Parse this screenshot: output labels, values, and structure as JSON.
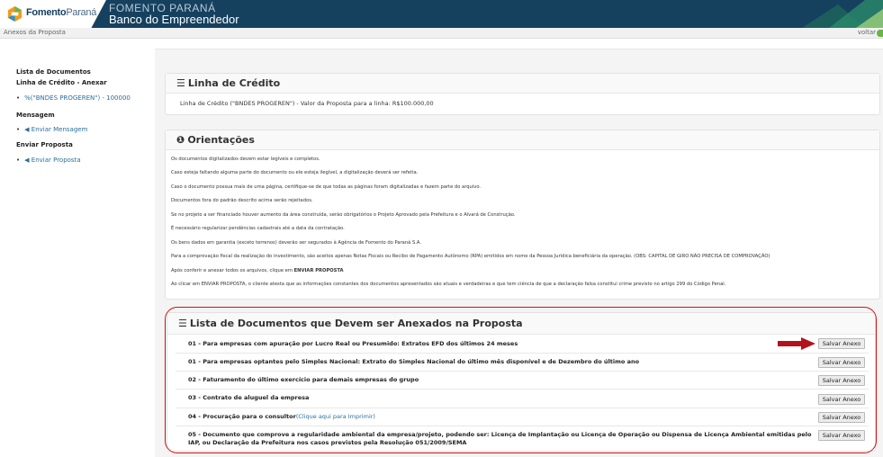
{
  "header": {
    "logo_bold": "Fomento",
    "logo_light": "Paraná",
    "title_line1": "FOMENTO PARANÁ",
    "title_line2": "Banco do Empreendedor"
  },
  "subbar": {
    "breadcrumb": "Anexos da Proposta",
    "back_label": "voltar"
  },
  "sidebar": {
    "docs_heading": "Lista de Documentos",
    "credit_heading": "Linha de Crédito - Anexar",
    "credit_item": "%(\"BNDES PROGEREN\") - 100000",
    "message_heading": "Mensagem",
    "message_item": "Enviar Mensagem",
    "submit_heading": "Enviar Proposta",
    "submit_item": "Enviar Proposta"
  },
  "credit_panel": {
    "title": "Linha de Crédito",
    "text": "Linha de Crédito (\"BNDES PROGEREN\") - Valor da Proposta para a linha: R$100.000,00"
  },
  "orientation_panel": {
    "title": "Orientações",
    "lines": [
      "Os documentos digitalizados devem estar legíveis e completos.",
      "Caso esteja faltando alguma parte do documento ou ele esteja ilegível, a digitalização deverá ser refeita.",
      "Caso o documento possua mais de uma página, certifique-se de que todas as páginas foram digitalizadas e fazem parte do arquivo.",
      "Documentos fora do padrão descrito acima serão rejeitados.",
      "Se no projeto a ser financiado houver aumento da área construída, serão obrigatórios o Projeto Aprovado pela Prefeitura e o Alvará de Construção.",
      "É necessário regularizar pendências cadastrais até a data da contratação.",
      "Os bens dados em garantia (exceto terrenos) deverão ser segurados à Agência de Fomento do Paraná S.A.",
      "Para a comprovação fiscal da realização do investimento, são aceitos apenas Notas Fiscais ou Recibo de Pagamento Autônomo (RPA) emitidos em nome da Pessoa Jurídica beneficiária da operação. (OBS: CAPITAL DE GIRO NÃO PRECISA DE COMPROVAÇÃO)",
      "Ao clicar em ENVIAR PROPOSTA, o cliente atesta que as informações constantes dos documentos apresentados são atuais e verdadeiras e que tem ciência de que a declaração falsa constitui crime previsto no artigo 299 do Código Penal."
    ],
    "line9_prefix": "Após conferir e anexar todos os arquivos, clique em ",
    "line9_bold": "ENVIAR PROPOSTA"
  },
  "docs_panel": {
    "title": "Lista de Documentos que Devem ser Anexados na Proposta",
    "button_label": "Salvar Anexo",
    "rows": [
      "01 - Para empresas com apuração por Lucro Real ou Presumido: Extratos EFD dos últimos 24 meses",
      "01 - Para empresas optantes pelo Simples Nacional: Extrato do Simples Nacional do último mês disponível e de Dezembro do último ano",
      "02 - Faturamento do último exercício para demais empresas do grupo",
      "03 - Contrato de aluguel da empresa",
      "04 - Procuração para o consultor",
      "05 - Documento que comprove a regularidade ambiental da empresa/projeto, podendo ser: Licença de Implantação ou Licença de Operação ou Dispensa de Licença Ambiental emitidas pelo",
      "IAP, ou Declaração da Prefeitura nos casos previstos pela Resolução 051/2009/SEMA"
    ],
    "row4_link": "(Clique aqui para Imprimir)"
  },
  "colors": {
    "header_bg": "#15415f",
    "link": "#2a6f9a",
    "highlight_outline": "#cc1414"
  }
}
